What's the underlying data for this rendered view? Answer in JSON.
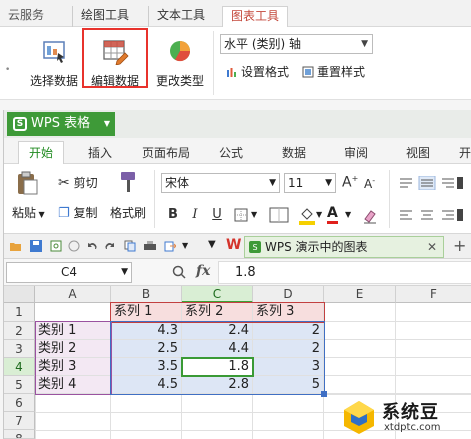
{
  "top_tabs": [
    "云服务",
    "绘图工具",
    "文本工具",
    "图表工具"
  ],
  "chart_ribbon": {
    "select_data": "选择数据",
    "edit_data": "编辑数据",
    "change_type": "更改类型",
    "axis_select": "水平 (类别) 轴",
    "set_format": "设置格式",
    "reset_style": "重置样式"
  },
  "app": {
    "title": "WPS 表格",
    "logo": "S"
  },
  "menu": [
    "开始",
    "插入",
    "页面布局",
    "公式",
    "数据",
    "审阅",
    "视图",
    "开"
  ],
  "toolbar": {
    "paste": "粘贴",
    "cut": "剪切",
    "copy": "复制",
    "format_painter": "格式刷",
    "font": "宋体",
    "font_size": "11",
    "bold": "B",
    "italic": "I",
    "underline": "U",
    "font_color": "A"
  },
  "doc_tab": {
    "title": "WPS 演示中的图表",
    "close": "✕",
    "add": "+"
  },
  "formula_bar": {
    "cell_ref": "C4",
    "fx": "fx",
    "value": "1.8"
  },
  "sheet": {
    "columns": [
      "A",
      "B",
      "C",
      "D",
      "E",
      "F"
    ],
    "rows": [
      "1",
      "2",
      "3",
      "4",
      "5",
      "6",
      "7",
      "8"
    ],
    "series_headers": [
      "系列 1",
      "系列 2",
      "系列 3"
    ],
    "data": [
      [
        "类别 1",
        "4.3",
        "2.4",
        "2"
      ],
      [
        "类别 2",
        "2.5",
        "4.4",
        "2"
      ],
      [
        "类别 3",
        "3.5",
        "1.8",
        "3"
      ],
      [
        "类别 4",
        "4.5",
        "2.8",
        "5"
      ]
    ]
  },
  "watermark": {
    "text": "系统豆",
    "url": "xtdptc.com"
  },
  "colors": {
    "wps_green": "#3e9a38",
    "highlight_red": "#e8322c",
    "tab_red": "#c4483b"
  }
}
